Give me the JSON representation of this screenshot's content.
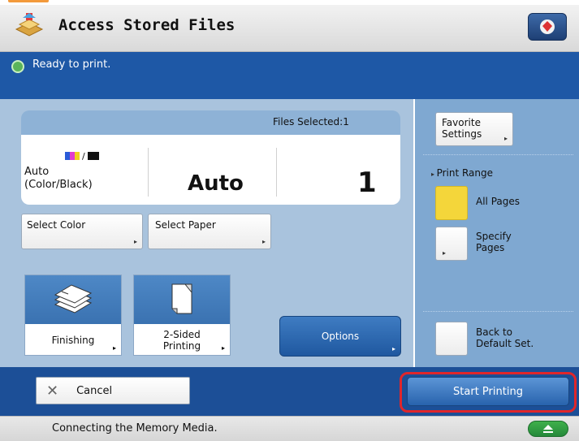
{
  "window": {
    "title": "Access Stored Files"
  },
  "status": {
    "message": "Ready to print."
  },
  "summary": {
    "files_selected": "Files Selected:1",
    "color_mode_line1": "Auto",
    "color_mode_line2": "(Color/Black)",
    "paper": "Auto",
    "copies": "1"
  },
  "buttons": {
    "select_color": "Select Color",
    "select_paper": "Select Paper",
    "finishing": "Finishing",
    "two_sided_line1": "2-Sided",
    "two_sided_line2": "Printing",
    "options": "Options",
    "cancel": "Cancel",
    "start_printing": "Start Printing"
  },
  "side": {
    "favorite_line1": "Favorite",
    "favorite_line2": "Settings",
    "print_range": "Print Range",
    "all_pages": "All Pages",
    "specify_line1": "Specify",
    "specify_line2": "Pages",
    "back_line1": "Back to",
    "back_line2": "Default Set.",
    "print_range_selected": "All Pages"
  },
  "footer": {
    "message": "Connecting the Memory Media."
  },
  "colors": {
    "accent_blue": "#1e58a6",
    "selected_yellow": "#f4d63a",
    "highlight_red": "#e0262b",
    "panel_blue": "#a9c3dd"
  },
  "icons": [
    "stored-files-icon",
    "home-icon",
    "status-ok-icon",
    "color-black-icon",
    "finishing-icon",
    "duplex-icon",
    "close-icon",
    "eject-icon"
  ]
}
